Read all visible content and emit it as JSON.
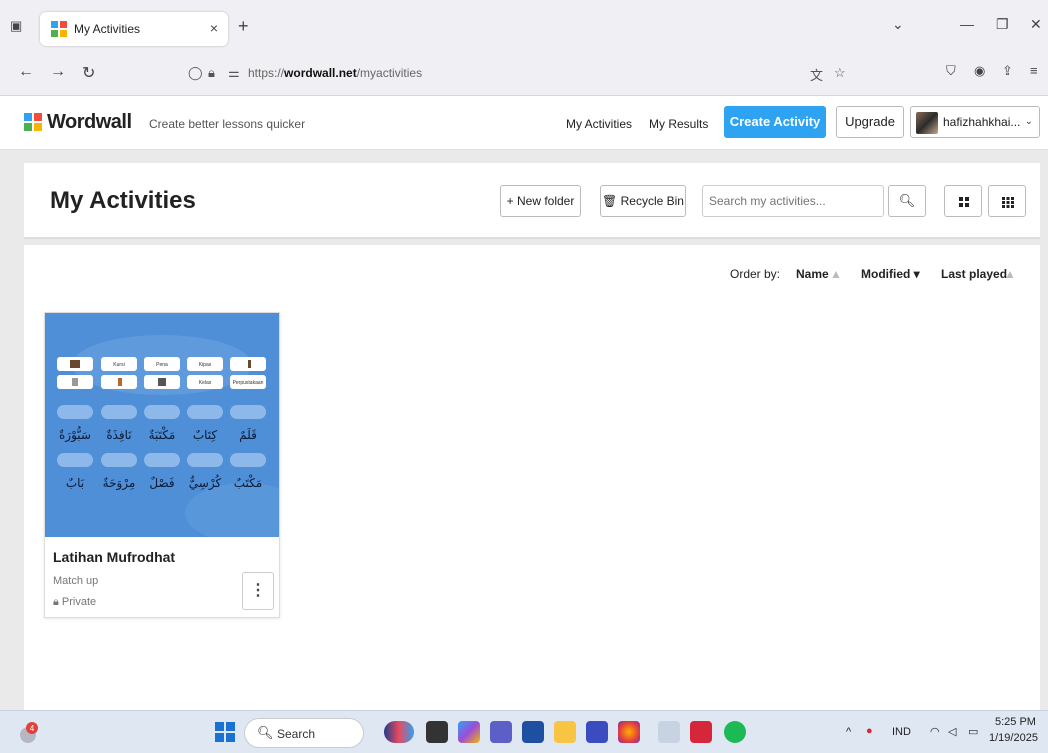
{
  "browser": {
    "tab_title": "My Activities",
    "tab_close": "×",
    "new_tab": "+",
    "url_prefix": "https://",
    "url_host": "wordwall.net",
    "url_path": "/myactivities"
  },
  "header": {
    "logo_text": "Wordwall",
    "tagline": "Create better lessons quicker",
    "nav_my_activities": "My Activities",
    "nav_my_results": "My Results",
    "create_activity": "Create Activity",
    "upgrade": "Upgrade",
    "user_name": "hafizhahkhai..."
  },
  "title_panel": {
    "title": "My Activities",
    "new_folder": "+ New folder",
    "recycle_bin": "🗑 Recycle Bin",
    "search_placeholder": "Search my activities..."
  },
  "order": {
    "label": "Order by:",
    "name": "Name",
    "modified": "Modified ▾",
    "last_played": "Last played"
  },
  "activity": {
    "title": "Latihan Mufrodhat",
    "type": "Match up",
    "privacy": "Private",
    "thumb_labels": [
      "Kursi",
      "Pena",
      "Kipas",
      "Kelas",
      "Perpustakaan"
    ],
    "thumb_arabic_row1": [
      "قَلَمٌ",
      "كِتَابٌ",
      "مَكْتَبَةٌ",
      "نَافِذَةٌ",
      "سَبُّوْرَةٌ"
    ],
    "thumb_arabic_row2": [
      "مَكْتَبٌ",
      "كُرْسِيٌّ",
      "فَصْلٌ",
      "مِرْوَحَةٌ",
      "بَابٌ"
    ]
  },
  "taskbar": {
    "search": "Search",
    "notification_count": "4",
    "lang": "IND",
    "time": "5:25 PM",
    "date": "1/19/2025"
  },
  "colors": {
    "accent": "#2ea3f2",
    "thumb_bg": "#4f8fd8"
  }
}
